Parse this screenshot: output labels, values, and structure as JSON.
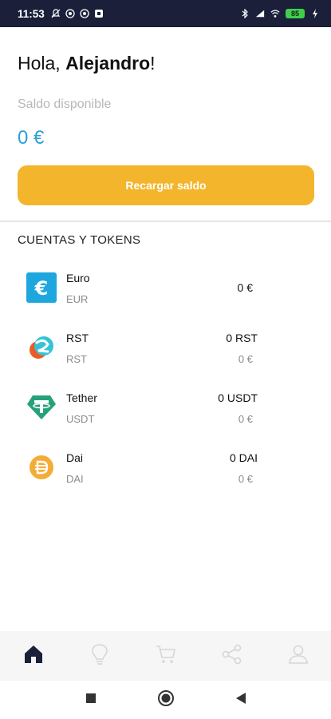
{
  "status_bar": {
    "time": "11:53",
    "battery": "85"
  },
  "header": {
    "greeting_prefix": "Hola, ",
    "user_name": "Alejandro",
    "greeting_suffix": "!",
    "balance_label": "Saldo disponible",
    "balance_value": "0 €",
    "recharge_label": "Recargar saldo"
  },
  "accounts": {
    "title": "CUENTAS Y TOKENS",
    "items": [
      {
        "name": "Euro",
        "code": "EUR",
        "amount": "0 €",
        "fiat": "",
        "icon": "euro-icon"
      },
      {
        "name": "RST",
        "code": "RST",
        "amount": "0 RST",
        "fiat": "0 €",
        "icon": "rst-token-icon"
      },
      {
        "name": "Tether",
        "code": "USDT",
        "amount": "0 USDT",
        "fiat": "0 €",
        "icon": "tether-icon"
      },
      {
        "name": "Dai",
        "code": "DAI",
        "amount": "0 DAI",
        "fiat": "0 €",
        "icon": "dai-icon"
      }
    ]
  },
  "bottom_nav": [
    {
      "icon": "home-icon",
      "active": true
    },
    {
      "icon": "lightbulb-icon",
      "active": false
    },
    {
      "icon": "cart-icon",
      "active": false
    },
    {
      "icon": "share-icon",
      "active": false
    },
    {
      "icon": "profile-icon",
      "active": false
    }
  ],
  "colors": {
    "accent_blue": "#2a9fd6",
    "button_yellow": "#f3b52b",
    "status_bar_bg": "#1b1f3a",
    "nav_active": "#1b1f3a",
    "nav_inactive": "#dcdcdc"
  }
}
